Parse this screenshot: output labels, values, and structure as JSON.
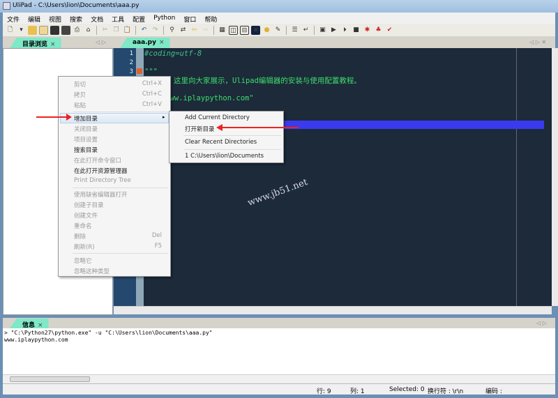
{
  "window": {
    "title": "UliPad - C:\\Users\\lion\\Documents\\aaa.py"
  },
  "menubar": [
    "文件",
    "编辑",
    "视图",
    "搜索",
    "文档",
    "工具",
    "配置",
    "Python",
    "窗口",
    "帮助"
  ],
  "toolbar": {
    "icons": [
      "new-file",
      "dropdown",
      "open-folder",
      "open",
      "save",
      "save-all",
      "print",
      "print-preview",
      "cut",
      "copy",
      "paste",
      "undo",
      "redo",
      "find",
      "replace",
      "back",
      "forward",
      "properties",
      "layout-1",
      "layout-2",
      "terminal",
      "hint",
      "edit",
      "options",
      "wrap",
      "shell",
      "run",
      "debug",
      "stop",
      "bug",
      "plugin",
      "check"
    ]
  },
  "left_tab": {
    "label": "目录浏览",
    "close": "×"
  },
  "editor_tab": {
    "label": "aaa.py",
    "close": "×"
  },
  "editor": {
    "line_numbers": [
      "1",
      "2",
      "3"
    ],
    "lines": [
      "#coding=utf-8",
      "",
      "\"\"\"",
      "玩蛇网：这里向大家展示，Ulipad编辑器的安装与使用配置教程。",
      "",
      "print \"www.iplaypython.com\""
    ]
  },
  "watermark": "www.jb51.net",
  "context_menu": {
    "items": [
      {
        "label": "剪切",
        "shortcut": "Ctrl+X",
        "enabled": false
      },
      {
        "label": "拷贝",
        "shortcut": "Ctrl+C",
        "enabled": false
      },
      {
        "label": "粘贴",
        "shortcut": "Ctrl+V",
        "enabled": false
      },
      {
        "label": "增加目录",
        "enabled": true,
        "submenu": true
      },
      {
        "label": "关闭目录",
        "enabled": false
      },
      {
        "label": "项目设置",
        "enabled": false
      },
      {
        "label": "搜索目录",
        "enabled": true
      },
      {
        "label": "在此打开命令窗口",
        "enabled": false
      },
      {
        "label": "在此打开资源管理器",
        "enabled": true
      },
      {
        "label": "Print Directory Tree",
        "enabled": false
      },
      {
        "label": "使用缺省编辑器打开",
        "enabled": false
      },
      {
        "label": "创建子目录",
        "enabled": false
      },
      {
        "label": "创建文件",
        "enabled": false
      },
      {
        "label": "重命名",
        "enabled": false
      },
      {
        "label": "删除",
        "shortcut": "Del",
        "enabled": false
      },
      {
        "label": "刷新(R)",
        "shortcut": "F5",
        "enabled": false
      },
      {
        "label": "忽略它",
        "enabled": false
      },
      {
        "label": "忽略这种类型",
        "enabled": false
      }
    ]
  },
  "submenu": {
    "items": [
      "Add Current Directory",
      "打开新目录",
      "Clear Recent Directories",
      "1 C:\\Users\\lion\\Documents"
    ]
  },
  "bottom_tab": {
    "label": "信息",
    "close": "×"
  },
  "output": {
    "lines": [
      "> \"C:\\Python27\\python.exe\" -u \"C:\\Users\\lion\\Documents\\aaa.py\"",
      "www.iplaypython.com"
    ]
  },
  "status": {
    "row": "行: 9",
    "col": "列: 1",
    "selected": "Selected: 0",
    "eol": "换行符 : \\r\\n",
    "encoding": "编码 :"
  },
  "colors": {
    "editor_bg": "#1c2a3a",
    "code": "#3fdc6a",
    "comment": "#3fbf8f",
    "highlight": "#3a3af0",
    "tab": "#7fe8c7",
    "annotation": "#e22222"
  }
}
